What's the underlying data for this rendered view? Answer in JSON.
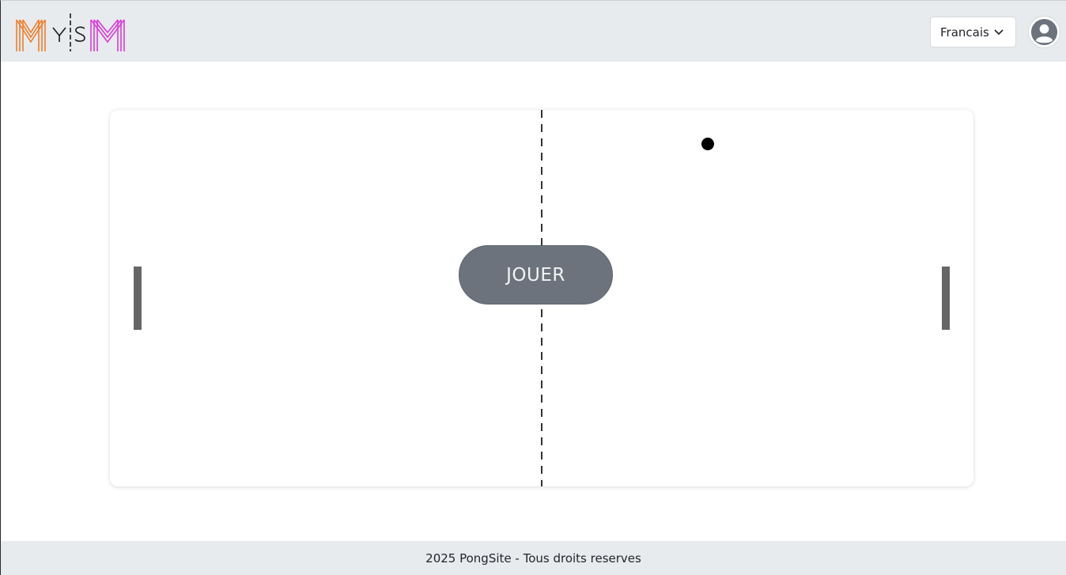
{
  "header": {
    "logo_text": "MYSM",
    "language_selected": "Francais",
    "colors": {
      "background": "#e8ebee",
      "logo_orange": "#f07d2a",
      "logo_magenta": "#d93ad8"
    }
  },
  "game": {
    "play_label": "JOUER",
    "colors": {
      "paddle": "#666666",
      "ball": "#000000",
      "button": "#6c737c"
    }
  },
  "footer": {
    "copyright": "2025 PongSite - Tous droits reserves"
  },
  "icons": [
    "chevron-down-icon",
    "user-avatar-icon"
  ]
}
